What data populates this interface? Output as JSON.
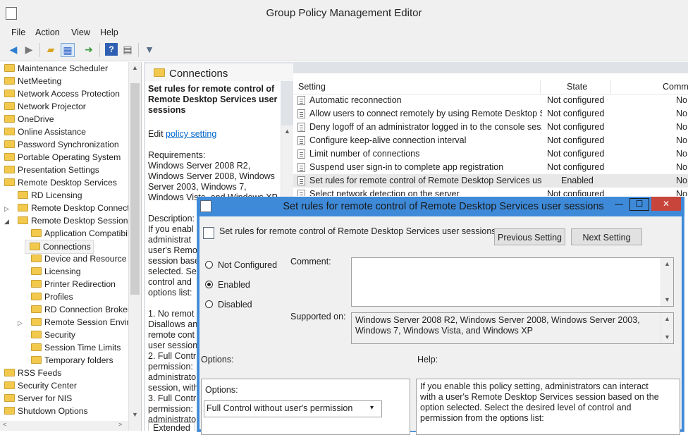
{
  "window": {
    "title": "Group Policy Management Editor"
  },
  "menu": [
    "File",
    "Action",
    "View",
    "Help"
  ],
  "toolbar_icons": [
    "back-arrow-icon",
    "forward-arrow-icon",
    "up-folder-icon",
    "show-hide-tree-icon",
    "export-list-icon",
    "help-icon",
    "properties-icon",
    "filter-icon"
  ],
  "tree": {
    "items": [
      {
        "label": "Maintenance Scheduler"
      },
      {
        "label": "NetMeeting"
      },
      {
        "label": "Network Access Protection"
      },
      {
        "label": "Network Projector"
      },
      {
        "label": "OneDrive"
      },
      {
        "label": "Online Assistance"
      },
      {
        "label": "Password Synchronization"
      },
      {
        "label": "Portable Operating System"
      },
      {
        "label": "Presentation Settings"
      },
      {
        "label": "Remote Desktop Services"
      },
      {
        "label": "RD Licensing"
      },
      {
        "label": "Remote Desktop Connectio"
      },
      {
        "label": "Remote Desktop Session H"
      },
      {
        "label": "Application Compatibil"
      },
      {
        "label": "Connections"
      },
      {
        "label": "Device and Resource Re"
      },
      {
        "label": "Licensing"
      },
      {
        "label": "Printer Redirection"
      },
      {
        "label": "Profiles"
      },
      {
        "label": "RD Connection Broker"
      },
      {
        "label": "Remote Session Enviror"
      },
      {
        "label": "Security"
      },
      {
        "label": "Session Time Limits"
      },
      {
        "label": "Temporary folders"
      },
      {
        "label": "RSS Feeds"
      },
      {
        "label": "Security Center"
      },
      {
        "label": "Server for NIS"
      },
      {
        "label": "Shutdown Options"
      }
    ]
  },
  "pane": {
    "title": "Connections",
    "desc_title": "Set rules for remote control of Remote Desktop Services user sessions",
    "edit_prefix": "Edit ",
    "edit_link": "policy setting ",
    "req_label": "Requirements:",
    "req_text": "Windows Server 2008 R2, Windows Server 2008, Windows Server 2003, Windows 7, Windows Vista, and Windows XP",
    "desc_lines": [
      "Description:",
      "If you enabl",
      "administrat",
      "user's Remo",
      "session base",
      "selected. Sel",
      "control and",
      "options list:",
      "",
      "1. No remot",
      "Disallows an",
      "remote cont",
      "user session",
      "2. Full Contr",
      "permission:",
      "administrato",
      "session, with",
      "3. Full Contr",
      "permission:",
      "administrato"
    ],
    "tab_label": "Extended"
  },
  "list": {
    "headers": {
      "setting": "Setting",
      "state": "State",
      "comment": "Comm"
    },
    "rows": [
      {
        "name": "Automatic reconnection",
        "state": "Not configured",
        "comment": "No"
      },
      {
        "name": "Allow users to connect remotely by using Remote Desktop S...",
        "state": "Not configured",
        "comment": "No"
      },
      {
        "name": "Deny logoff of an administrator logged in to the console ses...",
        "state": "Not configured",
        "comment": "No"
      },
      {
        "name": "Configure keep-alive connection interval",
        "state": "Not configured",
        "comment": "No"
      },
      {
        "name": "Limit number of connections",
        "state": "Not configured",
        "comment": "No"
      },
      {
        "name": "Suspend user sign-in to complete app registration",
        "state": "Not configured",
        "comment": "No"
      },
      {
        "name": "Set rules for remote control of Remote Desktop Services use...",
        "state": "Enabled",
        "comment": "No"
      },
      {
        "name": "Select network detection on the server",
        "state": "Not configured",
        "comment": "No"
      }
    ]
  },
  "dialog": {
    "title": "Set rules for remote control of Remote Desktop Services user sessions",
    "subtitle": "Set rules for remote control of Remote Desktop Services user sessions",
    "prev_button": "Previous Setting",
    "next_button": "Next Setting",
    "radios": {
      "not_configured": "Not Configured",
      "enabled": "Enabled",
      "disabled": "Disabled",
      "selected": "Enabled"
    },
    "comment_label": "Comment:",
    "comment_value": "",
    "supported_label": "Supported on:",
    "supported_value": "Windows Server 2008 R2, Windows Server 2008, Windows Server 2003, Windows 7, Windows Vista, and Windows XP",
    "options_header": "Options:",
    "help_header": "Help:",
    "options_label": "Options:",
    "options_selected": "Full Control without user's permission",
    "help_text": "If you enable this policy setting, administrators can interact with a user's Remote Desktop Services session based on the option selected. Select the desired level of control and permission from the options list:",
    "window_buttons": {
      "minimize": "—",
      "maximize": "☐",
      "close": "✕"
    }
  },
  "colors": {
    "accent": "#3e8ad9",
    "folder": "#f2c94c",
    "link": "#0066cc",
    "close_button": "#c7453b"
  }
}
